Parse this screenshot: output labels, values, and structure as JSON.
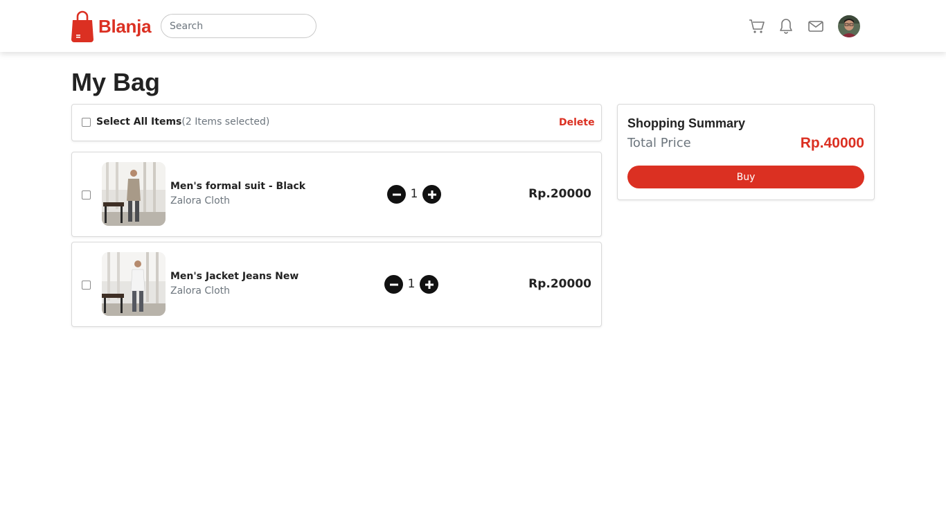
{
  "app": {
    "brand_name": "Blanja",
    "brand_color": "#db3022"
  },
  "header": {
    "search_placeholder": "Search",
    "icons": [
      "cart-icon",
      "bell-icon",
      "mail-icon"
    ],
    "avatar": "user-avatar"
  },
  "page": {
    "title": "My Bag"
  },
  "bag": {
    "select_all_label": "Select All Items",
    "selected_count_text": "(2 Items selected)",
    "delete_label": "Delete",
    "items": [
      {
        "name": "Men's formal suit - Black",
        "store": "Zalora Cloth",
        "quantity": "1",
        "price": "Rp.20000",
        "checked": false
      },
      {
        "name": "Men's Jacket Jeans New",
        "store": "Zalora Cloth",
        "quantity": "1",
        "price": "Rp.20000",
        "checked": false
      }
    ]
  },
  "summary": {
    "title": "Shopping Summary",
    "total_label": "Total Price",
    "total_value": "Rp.40000",
    "buy_label": "Buy"
  }
}
